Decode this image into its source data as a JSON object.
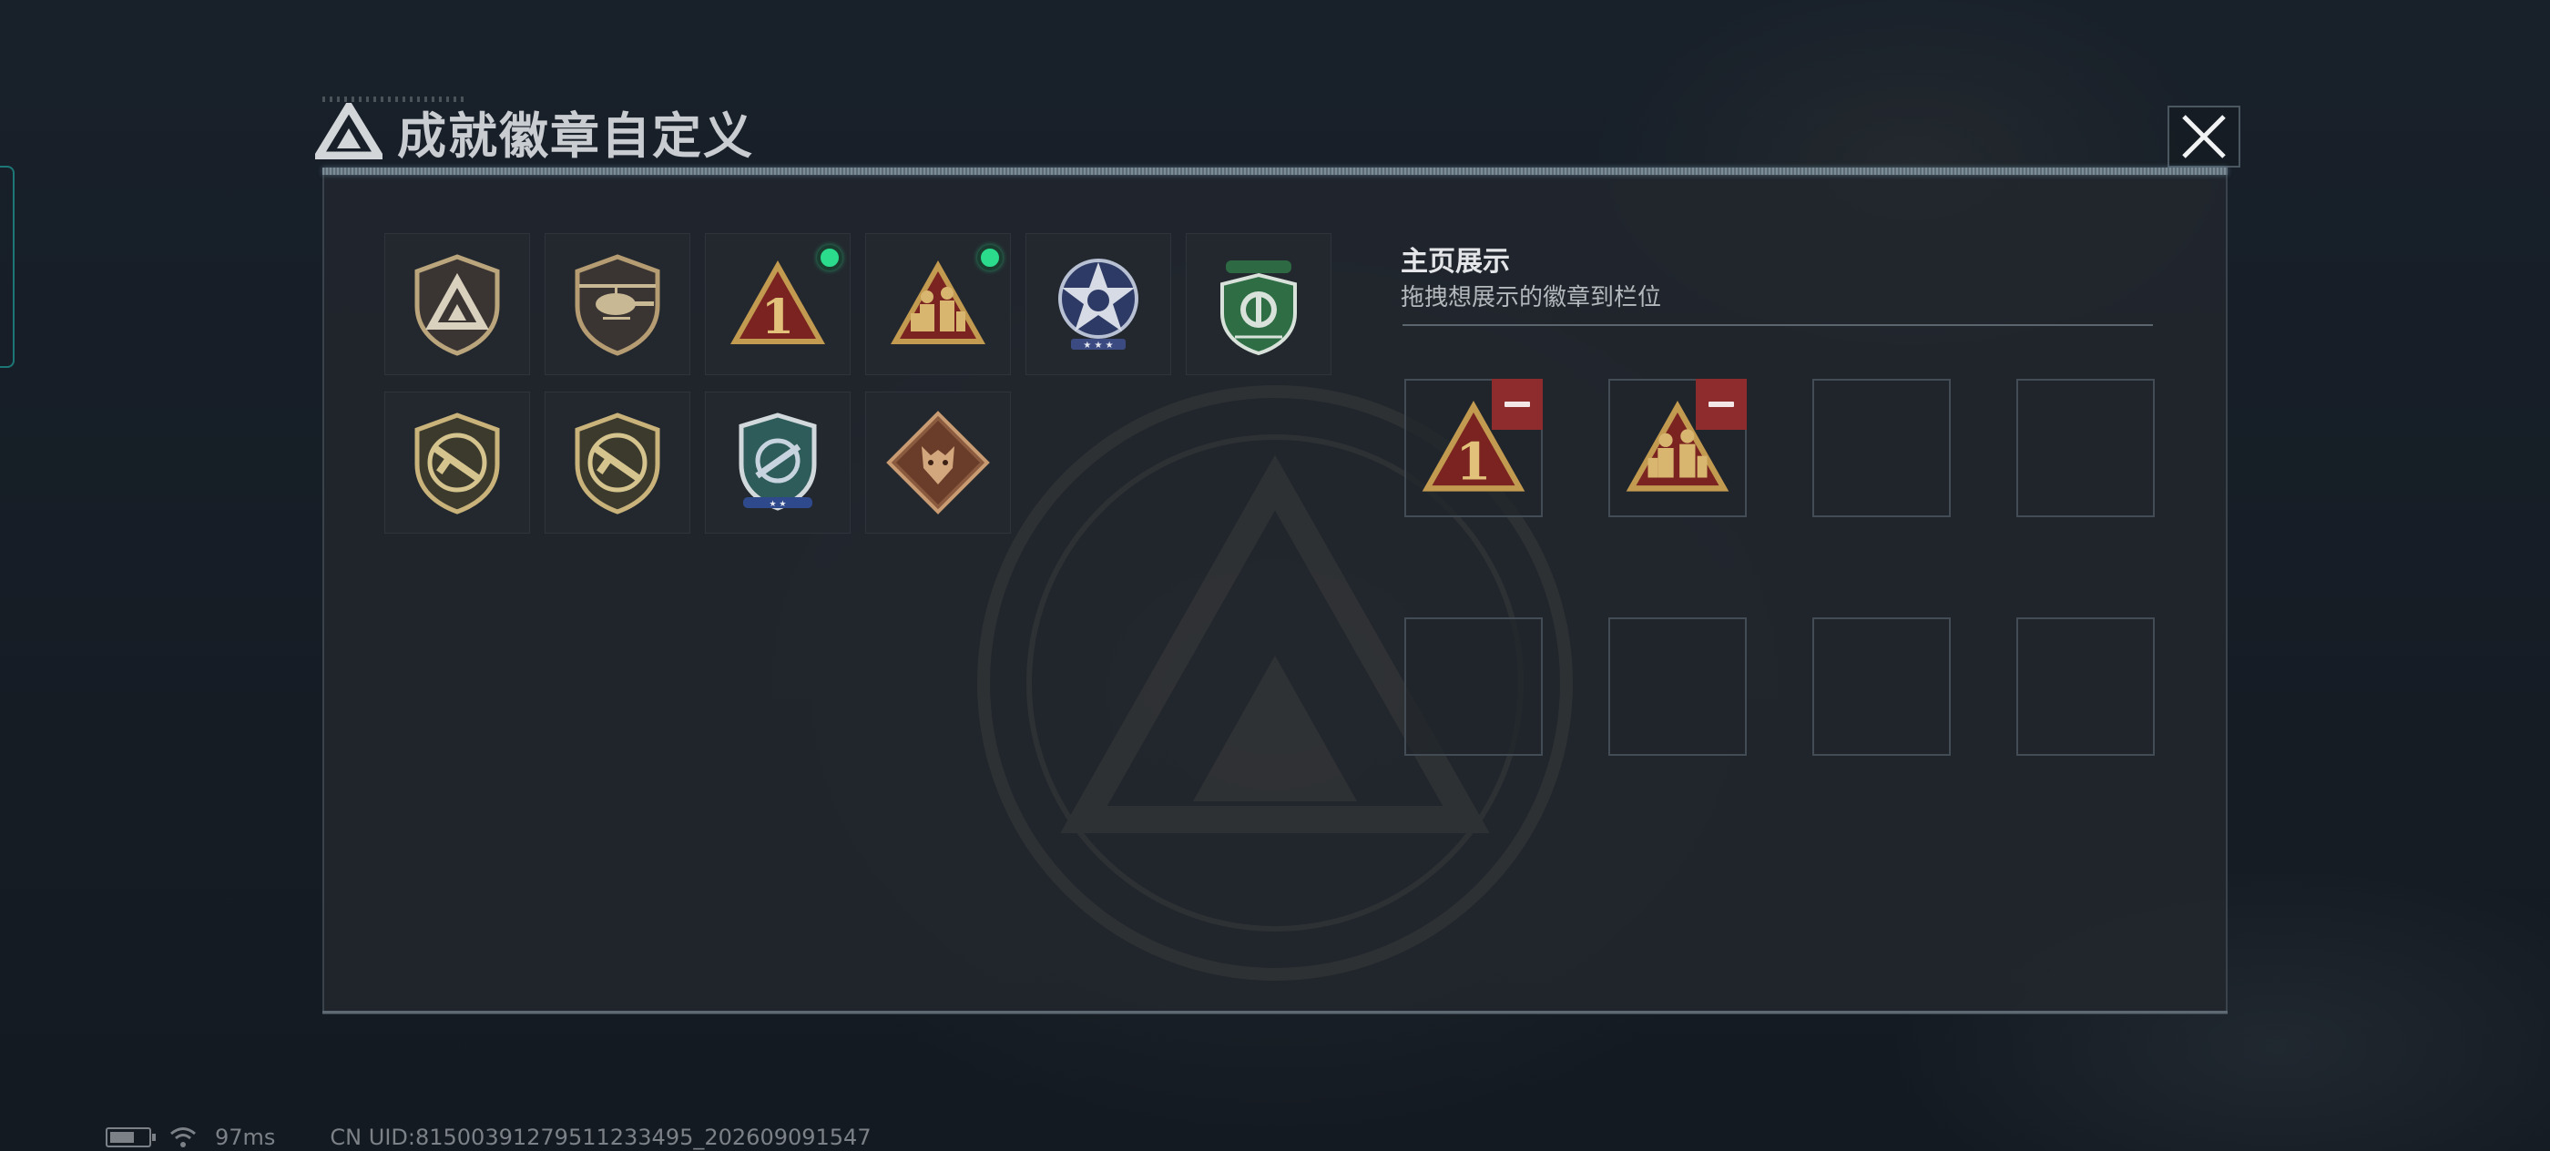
{
  "dialog": {
    "title": "成就徽章自定义"
  },
  "badges": [
    {
      "name": "badge-delta-shield",
      "equipped": false
    },
    {
      "name": "badge-helicopter",
      "equipped": false
    },
    {
      "name": "badge-number-one",
      "equipped": true
    },
    {
      "name": "badge-soldiers",
      "equipped": true
    },
    {
      "name": "badge-star-emblem",
      "equipped": false
    },
    {
      "name": "badge-green-shield",
      "equipped": false
    },
    {
      "name": "badge-rifle-gold-1",
      "equipped": false
    },
    {
      "name": "badge-rifle-gold-2",
      "equipped": false
    },
    {
      "name": "badge-blue-crest",
      "equipped": false
    },
    {
      "name": "badge-wolf-diamond",
      "equipped": false
    }
  ],
  "showcase": {
    "title": "主页展示",
    "subtitle": "拖拽想展示的徽章到栏位",
    "slots": [
      "badge-number-one",
      "badge-soldiers",
      null,
      null,
      null,
      null,
      null,
      null
    ]
  },
  "footer": {
    "ping": "97ms",
    "uid": "CN UID:815003912795112334​95_202609091547"
  },
  "colors": {
    "equipped_dot": "#2bdc8c",
    "remove_button": "#8d2b2d"
  }
}
